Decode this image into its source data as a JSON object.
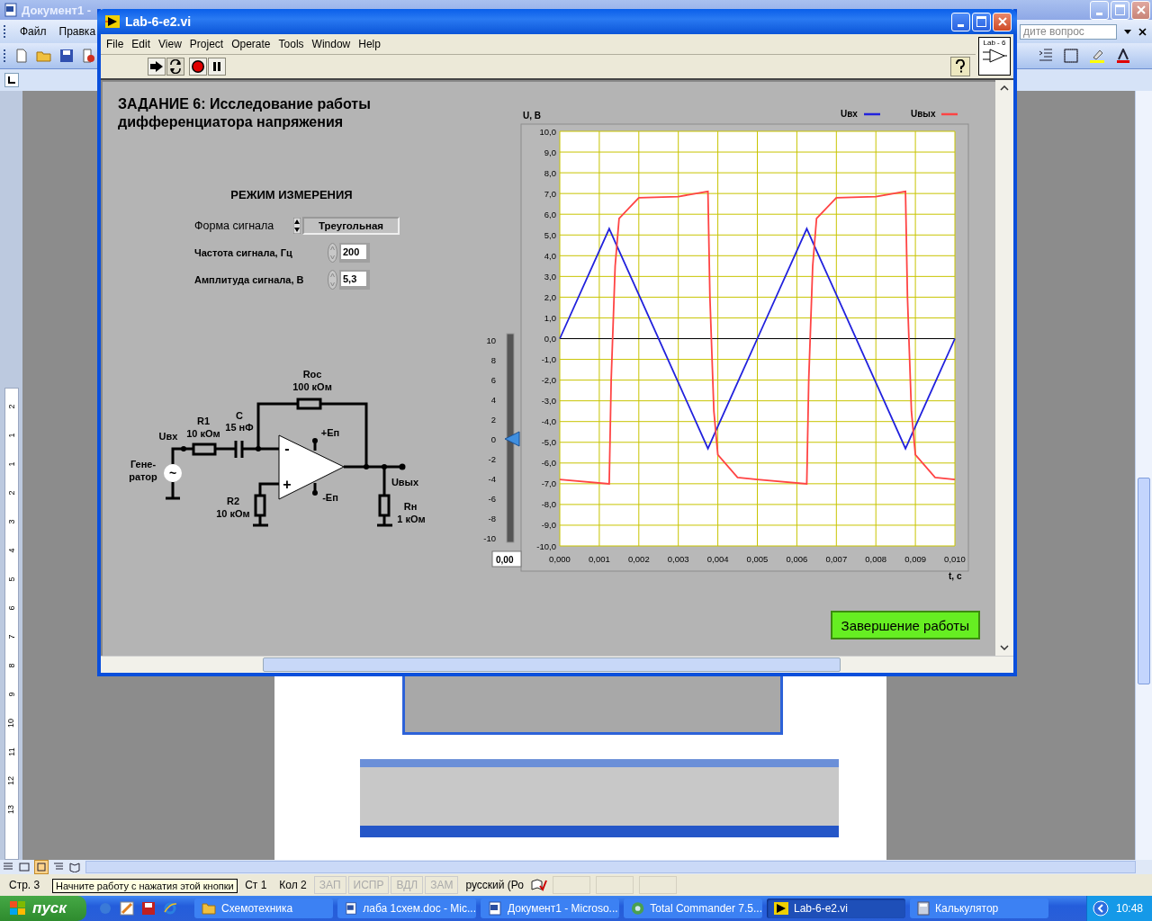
{
  "word_window": {
    "title": "Документ1 -",
    "menu": [
      "Файл",
      "Правка"
    ],
    "help_box": {
      "placeholder": "дите вопрос"
    },
    "ruler_numbers": [
      "2",
      "1",
      "1",
      "2",
      "3",
      "4",
      "5",
      "6",
      "7",
      "8",
      "9",
      "10",
      "11",
      "12",
      "13"
    ],
    "status_bar": {
      "items": [
        {
          "text": "Стр. 3",
          "disabled": false
        },
        {
          "text": "Ст 1",
          "disabled": false
        },
        {
          "text": "Кол 2",
          "disabled": false
        },
        {
          "text": "ЗАП",
          "disabled": true
        },
        {
          "text": "ИСПР",
          "disabled": true
        },
        {
          "text": "ВДЛ",
          "disabled": true
        },
        {
          "text": "ЗАМ",
          "disabled": true
        },
        {
          "text": "русский (Ро",
          "disabled": false
        }
      ],
      "tooltip": "Начните работу с нажатия этой кнопки"
    }
  },
  "labview_window": {
    "title": "Lab-6-e2.vi",
    "menu": [
      "File",
      "Edit",
      "View",
      "Project",
      "Operate",
      "Tools",
      "Window",
      "Help"
    ],
    "vi_icon_label": "Lab - 6",
    "panel": {
      "title": "ЗАДАНИЕ 6: Исследование работы дифференциатора напряжения",
      "mode": {
        "heading": "РЕЖИМ ИЗМЕРЕНИЯ",
        "controls": [
          {
            "kind": "ring",
            "label": "Форма сигнала",
            "value": "Треугольная"
          },
          {
            "kind": "numeric",
            "label": "Частота сигнала, Гц",
            "value": "200"
          },
          {
            "kind": "numeric",
            "label": "Амплитуда сигнала, В",
            "value": "5,3"
          }
        ]
      },
      "circuit": {
        "feedback_resistor": {
          "name": "Rос",
          "value": "100 кОм"
        },
        "input_resistor": {
          "name": "R1",
          "value": "10 кОм"
        },
        "capacitor": {
          "name": "C",
          "value": "15 нФ"
        },
        "input_label": "Uвх",
        "generator": [
          "Гене-",
          "ратор"
        ],
        "generator_symbol": "~",
        "plus_supply": "+Еп",
        "minus_supply": "-Еп",
        "inverting_sign": "-",
        "noninverting_sign": "+",
        "output_label": "Uвых",
        "ground_resistor": {
          "name": "R2",
          "value": "10 кОм"
        },
        "load_resistor": {
          "name": "Rн",
          "value": "1 кОм"
        }
      },
      "slider": {
        "ticks": [
          "10",
          "8",
          "6",
          "4",
          "2",
          "0",
          "-2",
          "-4",
          "-6",
          "-8",
          "-10"
        ],
        "level": 0.5,
        "value": "0,00"
      },
      "chart": {
        "chart_data": {
          "type": "line",
          "ylabel": "U, В",
          "xlabel": "t, c",
          "grid": true,
          "legend": true,
          "x": [
            0,
            0.00125,
            0.0013,
            0.0014,
            0.0015,
            0.002,
            0.003,
            0.00375,
            0.0038,
            0.0039,
            0.004,
            0.0045,
            0.005,
            0.00625,
            0.0063,
            0.0064,
            0.0065,
            0.007,
            0.008,
            0.00875,
            0.0088,
            0.0089,
            0.009,
            0.0095,
            0.01
          ],
          "series": [
            {
              "name": "Uвх",
              "color": "#2222dd",
              "values": [
                0,
                5.3,
                5.09,
                4.66,
                4.24,
                2.12,
                -2.12,
                -5.3,
                -5.09,
                -4.66,
                -4.24,
                -2.12,
                0,
                5.3,
                5.09,
                4.66,
                4.24,
                2.12,
                -2.12,
                -5.3,
                -5.09,
                -4.66,
                -4.24,
                -2.12,
                0
              ]
            },
            {
              "name": "Uвых",
              "color": "#ff4444",
              "values": [
                -6.8,
                -7.0,
                -2.0,
                3.5,
                5.8,
                6.8,
                6.85,
                7.1,
                2.0,
                -3.5,
                -5.6,
                -6.7,
                -6.8,
                -7.0,
                -2.0,
                3.5,
                5.8,
                6.8,
                6.85,
                7.1,
                2.0,
                -3.5,
                -5.6,
                -6.7,
                -6.8
              ]
            }
          ],
          "xlim": [
            0,
            0.01
          ],
          "ylim": [
            -10,
            10
          ],
          "xticks": [
            {
              "value": 0,
              "label": "0,000"
            },
            {
              "value": 0.001,
              "label": "0,001"
            },
            {
              "value": 0.002,
              "label": "0,002"
            },
            {
              "value": 0.003,
              "label": "0,003"
            },
            {
              "value": 0.004,
              "label": "0,004"
            },
            {
              "value": 0.005,
              "label": "0,005"
            },
            {
              "value": 0.006,
              "label": "0,006"
            },
            {
              "value": 0.007,
              "label": "0,007"
            },
            {
              "value": 0.008,
              "label": "0,008"
            },
            {
              "value": 0.009,
              "label": "0,009"
            },
            {
              "value": 0.01,
              "label": "0,010"
            }
          ],
          "yticks": [
            {
              "value": 10,
              "label": "10,0"
            },
            {
              "value": 9,
              "label": "9,0"
            },
            {
              "value": 8,
              "label": "8,0"
            },
            {
              "value": 7,
              "label": "7,0"
            },
            {
              "value": 6,
              "label": "6,0"
            },
            {
              "value": 5,
              "label": "5,0"
            },
            {
              "value": 4,
              "label": "4,0"
            },
            {
              "value": 3,
              "label": "3,0"
            },
            {
              "value": 2,
              "label": "2,0"
            },
            {
              "value": 1,
              "label": "1,0"
            },
            {
              "value": 0,
              "label": "0,0"
            },
            {
              "value": -1,
              "label": "-1,0"
            },
            {
              "value": -2,
              "label": "-2,0"
            },
            {
              "value": -3,
              "label": "-3,0"
            },
            {
              "value": -4,
              "label": "-4,0"
            },
            {
              "value": -5,
              "label": "-5,0"
            },
            {
              "value": -6,
              "label": "-6,0"
            },
            {
              "value": -7,
              "label": "-7,0"
            },
            {
              "value": -8,
              "label": "-8,0"
            },
            {
              "value": -9,
              "label": "-9,0"
            },
            {
              "value": -10,
              "label": "-10,0"
            }
          ]
        }
      },
      "exit_button": "Завершение работы"
    }
  },
  "taskbar": {
    "start": "пуск",
    "tasks": [
      {
        "label": "Схемотехника",
        "kind": "folder",
        "selected": false
      },
      {
        "label": "лаба 1схем.doc - Mic...",
        "kind": "word",
        "selected": false
      },
      {
        "label": "Документ1 - Microso...",
        "kind": "word",
        "selected": false
      },
      {
        "label": "Total Commander 7.5...",
        "kind": "tc",
        "selected": false
      },
      {
        "label": "Lab-6-e2.vi",
        "kind": "labview",
        "selected": true
      },
      {
        "label": "Калькулятор",
        "kind": "calc",
        "selected": false
      }
    ],
    "clock": "10:48"
  }
}
